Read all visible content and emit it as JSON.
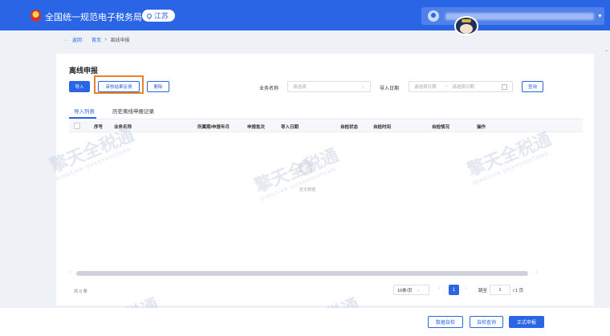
{
  "header": {
    "brand": "全国统一规范电子税务局",
    "location": "江苏"
  },
  "breadcrumb": {
    "back": "返回",
    "home": "首页",
    "sep": ">",
    "current": "离线申报"
  },
  "page": {
    "title": "离线申报",
    "toolbar": {
      "import": "导入",
      "review_feedback": "审核结果反馈",
      "delete": "删除"
    },
    "filters": {
      "business_label": "业务名称",
      "business_placeholder": "请选择",
      "date_label": "导入日期",
      "date_start_placeholder": "请选择日期",
      "date_sep": "-",
      "date_end_placeholder": "请选择日期",
      "query": "查询"
    },
    "tabs": [
      {
        "label": "导入列表",
        "active": true
      },
      {
        "label": "历史离线申报记录",
        "active": false
      }
    ],
    "table": {
      "columns": [
        "序号",
        "业务名称",
        "所属期/申报年月",
        "申报批次",
        "导入日期",
        "自检状态",
        "自检时间",
        "自检情况",
        "操作"
      ]
    },
    "empty_text": "暂无数据",
    "pagination": {
      "total": "共 0 条",
      "page_size": "10条/页",
      "current_page": "1",
      "jump_label": "跳至",
      "jump_value": "1",
      "page_suffix": "/ 1 页"
    }
  },
  "footer_buttons": {
    "data_check": "数据自检",
    "check_query": "自检查询",
    "submit": "正式申报"
  },
  "watermark": {
    "text": "擎天全税通",
    "sub": "QINGTIAN QUANSHUITONG"
  },
  "colors": {
    "primary": "#2a65e6",
    "highlight": "#e8832b"
  }
}
